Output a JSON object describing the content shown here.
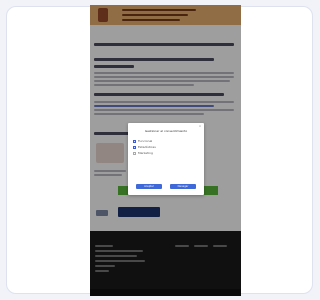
{
  "dialog": {
    "title": "Gestionar el consentimiento",
    "close_glyph": "×",
    "options": [
      {
        "label": "Funcional",
        "checked": true
      },
      {
        "label": "Estadísticas",
        "checked": true
      },
      {
        "label": "Marketing",
        "checked": false
      }
    ],
    "accept_label": "Aceptar",
    "deny_label": "Denegar"
  },
  "colors": {
    "header": "#e8b070",
    "footer": "#1a1a1a",
    "accent_blue": "#3f69d8",
    "green_bar": "#59b83a",
    "dark_button": "#1f3470"
  }
}
